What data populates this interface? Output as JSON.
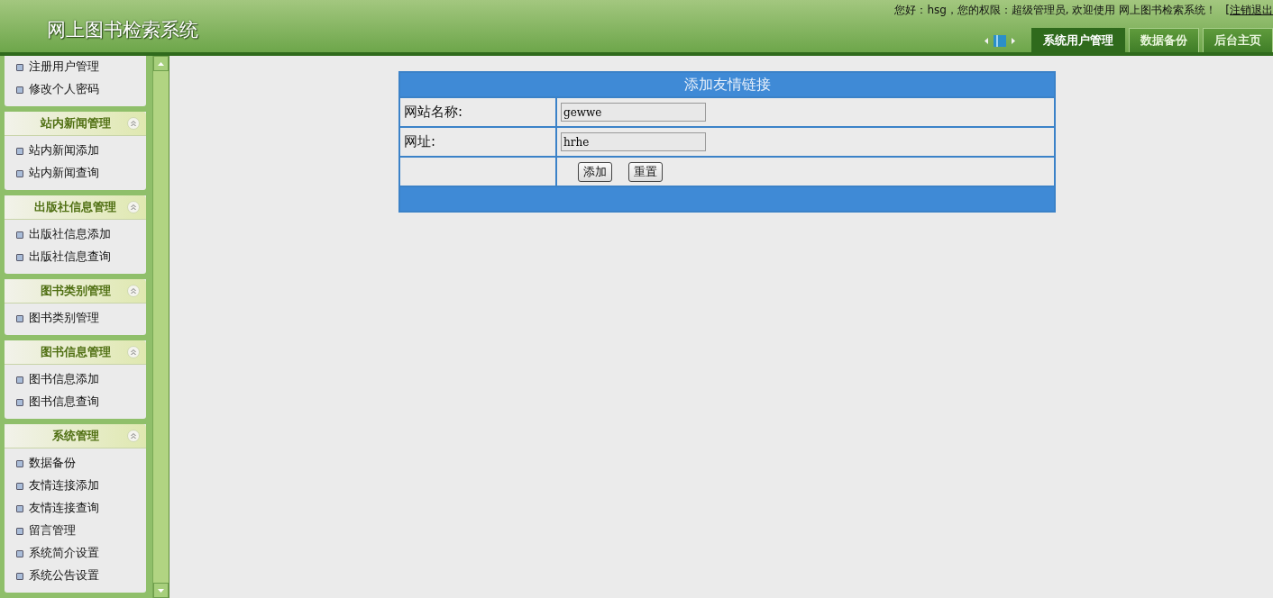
{
  "header": {
    "title": "网上图书检索系统",
    "greeting": "您好：hsg，您的权限：超级管理员, 欢迎使用 网上图书检索系统！",
    "logout": "[注销退出",
    "tabs": [
      {
        "label": "系统用户管理",
        "selected": true
      },
      {
        "label": "数据备份",
        "selected": false
      },
      {
        "label": "后台主页",
        "selected": false
      }
    ]
  },
  "sidebar": {
    "groups": [
      {
        "items": [
          "注册用户管理",
          "修改个人密码"
        ]
      },
      {
        "title": "站内新闻管理",
        "expanded": true,
        "items": [
          "站内新闻添加",
          "站内新闻查询"
        ]
      },
      {
        "title": "出版社信息管理",
        "expanded": true,
        "items": [
          "出版社信息添加",
          "出版社信息查询"
        ]
      },
      {
        "title": "图书类别管理",
        "expanded": true,
        "items": [
          "图书类别管理"
        ]
      },
      {
        "title": "图书信息管理",
        "expanded": true,
        "items": [
          "图书信息添加",
          "图书信息查询"
        ]
      },
      {
        "title": "系统管理",
        "expanded": true,
        "items": [
          "数据备份",
          "友情连接添加",
          "友情连接查询",
          "留言管理",
          "系统简介设置",
          "系统公告设置"
        ]
      }
    ]
  },
  "form": {
    "title": "添加友情链接",
    "fields": [
      {
        "label": "网站名称:",
        "value": "gewwe"
      },
      {
        "label": "网址:",
        "value": "hrhe"
      }
    ],
    "buttons": [
      "添加",
      "重置"
    ]
  }
}
